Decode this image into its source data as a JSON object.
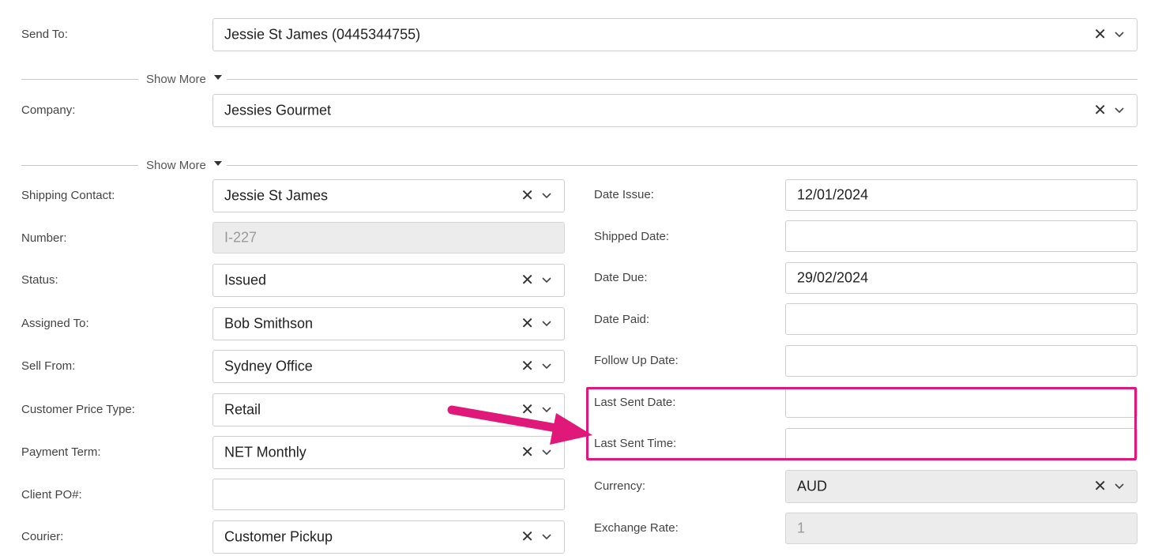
{
  "send_to": {
    "label": "Send To:",
    "value": "Jessie St James (0445344755)"
  },
  "show_more_1": {
    "label": "Show More"
  },
  "company": {
    "label": "Company:",
    "value": "Jessies Gourmet"
  },
  "show_more_2": {
    "label": "Show More"
  },
  "left": {
    "shipping_contact": {
      "label": "Shipping Contact:",
      "value": "Jessie St James"
    },
    "number": {
      "label": "Number:",
      "value": "I-227"
    },
    "status": {
      "label": "Status:",
      "value": "Issued"
    },
    "assigned_to": {
      "label": "Assigned To:",
      "value": "Bob Smithson"
    },
    "sell_from": {
      "label": "Sell From:",
      "value": "Sydney Office"
    },
    "customer_price_type": {
      "label": "Customer Price Type:",
      "value": "Retail"
    },
    "payment_term": {
      "label": "Payment Term:",
      "value": "NET Monthly"
    },
    "client_po": {
      "label": "Client PO#:",
      "value": ""
    },
    "courier": {
      "label": "Courier:",
      "value": "Customer Pickup"
    }
  },
  "right": {
    "date_issue": {
      "label": "Date Issue:",
      "value": "12/01/2024"
    },
    "shipped_date": {
      "label": "Shipped Date:",
      "value": ""
    },
    "date_due": {
      "label": "Date Due:",
      "value": "29/02/2024"
    },
    "date_paid": {
      "label": "Date Paid:",
      "value": ""
    },
    "follow_up_date": {
      "label": "Follow Up Date:",
      "value": ""
    },
    "last_sent_date": {
      "label": "Last Sent Date:",
      "value": ""
    },
    "last_sent_time": {
      "label": "Last Sent Time:",
      "value": ""
    },
    "currency": {
      "label": "Currency:",
      "value": "AUD"
    },
    "exchange_rate": {
      "label": "Exchange Rate:",
      "value": "1"
    }
  },
  "icons": {
    "clear": "close-icon",
    "dropdown": "chevron-down-icon",
    "expand": "caret-down-icon",
    "annotation": "arrow-icon"
  },
  "colors": {
    "highlight": "#e0187a",
    "border": "#cfcfcf",
    "disabled_bg": "#ececec"
  }
}
